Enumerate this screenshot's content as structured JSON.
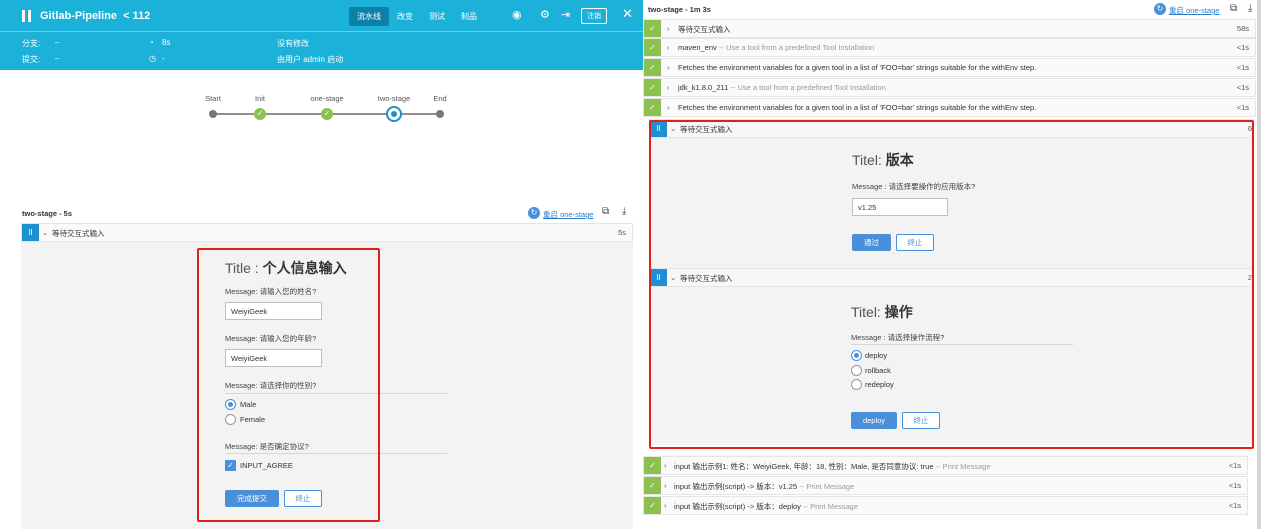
{
  "header": {
    "title": "Gitlab-Pipeline",
    "build_number": "< 112",
    "tabs": [
      "流水线",
      "改变",
      "测试",
      "制品"
    ],
    "logout": "注销",
    "branch_label": "分支:",
    "branch_value": "–",
    "commit_label": "提交:",
    "commit_value": "–",
    "duration": "8s",
    "duration_icon": "clock-icon",
    "time_value": "-",
    "no_change": "没有修改",
    "started_by": "由用户 admin 启动"
  },
  "pipeline": {
    "stages": [
      "Start",
      "Init",
      "one-stage",
      "two-stage",
      "End"
    ]
  },
  "left_stage": {
    "header": "two-stage - 5s",
    "restart_label": "重启 one-stage",
    "step_label": "等待交互式输入",
    "step_time": "5s",
    "form": {
      "title_prefix": "Title : ",
      "title_bold": "个人信息输入",
      "msg_name": "Message: 请输入您的姓名?",
      "name_value": "WeiyiGeek",
      "msg_age": "Message: 请输入您的年龄?",
      "age_value": "WeiyiGeek",
      "msg_gender": "Message: 请选择你的性别?",
      "gender_options": [
        "Male",
        "Female"
      ],
      "msg_agree": "Message: 是否确定协议?",
      "agree_label": "INPUT_AGREE",
      "submit": "完成提交",
      "abort": "终止"
    }
  },
  "right_stage": {
    "header": "two-stage - 1m 3s",
    "restart_label": "重启 one-stage",
    "steps": [
      {
        "text": "等待交互式输入",
        "desc": "",
        "time": "58s"
      },
      {
        "text": "maven_env",
        "desc": " -- Use a tool from a predefined Tool Installation",
        "time": "<1s"
      },
      {
        "text": "Fetches the environment variables for a given tool in a list of 'FOO=bar' strings suitable for the withEnv step.",
        "desc": "",
        "time": "<1s"
      },
      {
        "text": "jdk_k1.8.0_211",
        "desc": " -- Use a tool from a predefined Tool Installation",
        "time": "<1s"
      },
      {
        "text": "Fetches the environment variables for a given tool in a list of 'FOO=bar' strings suitable for the withEnv step.",
        "desc": "",
        "time": "<1s"
      }
    ],
    "wait1": {
      "label": "等待交互式输入",
      "time": "6",
      "title_prefix": "Titel: ",
      "title_bold": "版本",
      "message": "Message : 请选择要操作的应用版本?",
      "input_value": "v1.25",
      "submit": "通过",
      "abort": "终止"
    },
    "wait2": {
      "label": "等待交互式输入",
      "time": "2",
      "title_prefix": "Titel: ",
      "title_bold": "操作",
      "message": "Message : 请选择操作流程?",
      "options": [
        "deploy",
        "rollback",
        "redeploy"
      ],
      "submit": "deploy",
      "abort": "终止"
    },
    "outputs": [
      {
        "text": "input 输出示例1: 姓名：WeiyiGeek, 年龄：18, 性别：Male, 是否同意协议: true",
        "desc": " -- Print Message",
        "time": "<1s"
      },
      {
        "text": "input 输出示例(script) -> 版本：v1.25",
        "desc": " -- Print Message",
        "time": "<1s"
      },
      {
        "text": "input 输出示例(script) -> 版本：deploy",
        "desc": " -- Print Message",
        "time": "<1s"
      }
    ]
  }
}
